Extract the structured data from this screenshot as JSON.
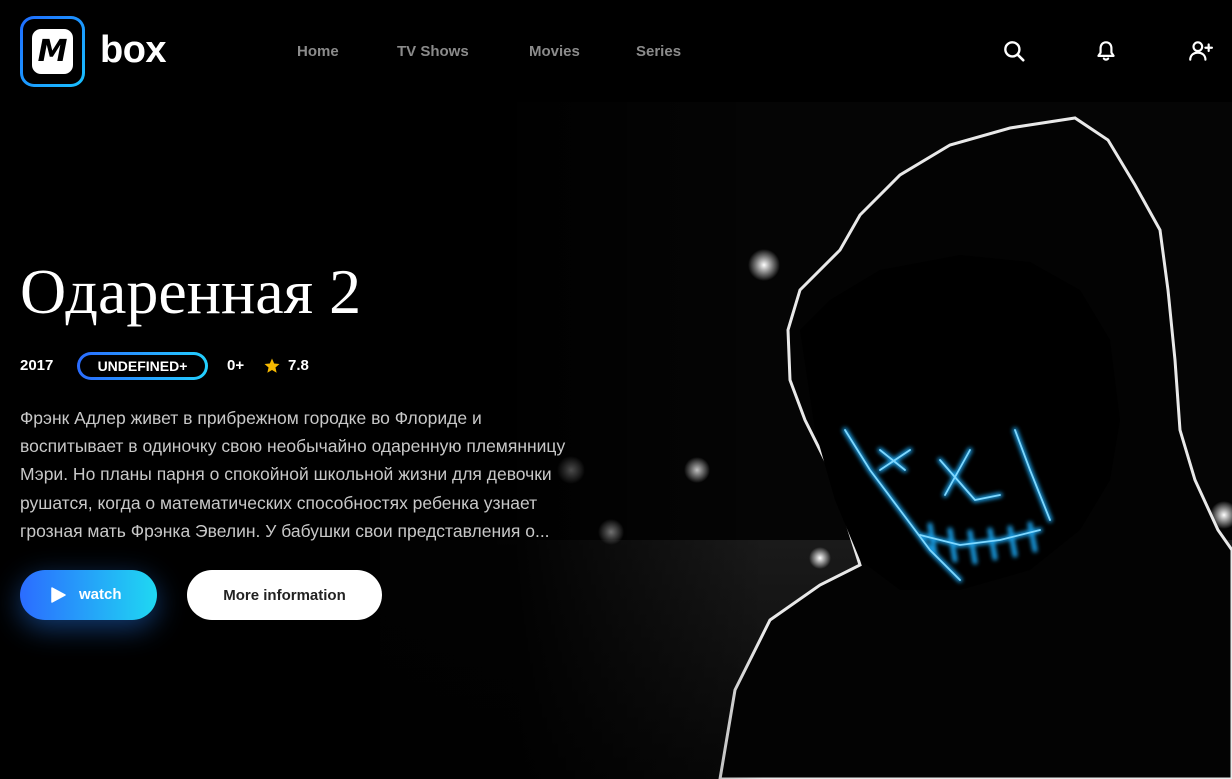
{
  "brand": {
    "logo_letter": "M",
    "name": "box"
  },
  "nav": {
    "items": [
      "Home",
      "TV Shows",
      "Movies",
      "Series"
    ]
  },
  "header_icons": [
    "search-icon",
    "bell-icon",
    "add-user-icon"
  ],
  "hero": {
    "title": "Одаренная 2",
    "year": "2017",
    "badge": "UNDEFINED+",
    "age": "0+",
    "rating": "7.8",
    "description": "Фрэнк Адлер живет в прибрежном городке во Флориде и воспитывает в одиночку свою необычайно одаренную племянницу Мэри. Но планы парня о спокойной школьной жизни для девочки рушатся, когда о математических способностях ребенка узнает грозная мать Фрэнка Эвелин. У бабушки свои представления о...",
    "watch_label": "watch",
    "info_label": "More information"
  },
  "colors": {
    "accent_start": "#2b6cff",
    "accent_end": "#1fd8f2",
    "neon": "#1ea8ff",
    "star": "#f5b800"
  }
}
